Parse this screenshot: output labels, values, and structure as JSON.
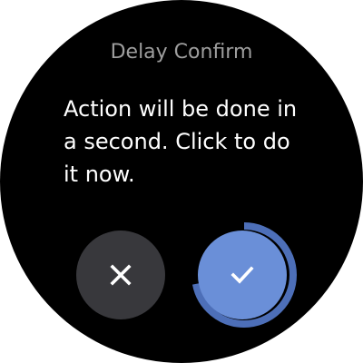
{
  "dialog": {
    "title": "Delay Confirm",
    "message": "Action will be done in a second. Click to do it now."
  },
  "buttons": {
    "cancel": {
      "icon": "close-icon",
      "color": "#38383c"
    },
    "confirm": {
      "icon": "checkmark-icon",
      "color": "#6a8fd8"
    }
  },
  "timer": {
    "progress": 0.72,
    "ring_color": "#4d6fb8"
  },
  "colors": {
    "background": "#000000",
    "title": "#9e9e9e",
    "message": "#ffffff"
  }
}
